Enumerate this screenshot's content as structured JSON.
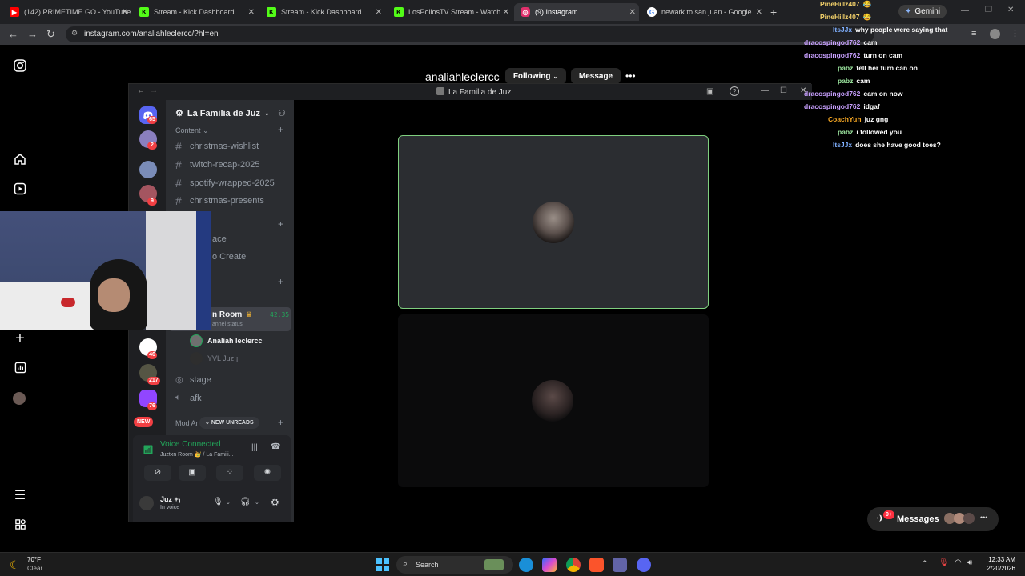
{
  "browser": {
    "tabs": [
      {
        "title": "(142) PRIMETIME GO - YouTube",
        "icon": "youtube-icon",
        "color": "#ff0000"
      },
      {
        "title": "Stream - Kick Dashboard",
        "icon": "kick-icon",
        "color": "#53fc18"
      },
      {
        "title": "Stream - Kick Dashboard",
        "icon": "kick-icon",
        "color": "#53fc18"
      },
      {
        "title": "LosPollosTV Stream - Watch Li",
        "icon": "kick-icon",
        "color": "#53fc18"
      },
      {
        "title": "(9) Instagram",
        "icon": "instagram-icon",
        "color": "#e1306c",
        "active": true
      },
      {
        "title": "newark to san juan - Google Se",
        "icon": "google-icon",
        "color": "#4285f4"
      }
    ],
    "url": "instagram.com/analiahleclercc/?hl=en",
    "gemini_label": "Gemini"
  },
  "instagram": {
    "username": "analiahleclercc",
    "following_label": "Following",
    "message_label": "Message",
    "more_label": "•••",
    "messages_label": "Messages",
    "messages_badge": "9+"
  },
  "discord": {
    "window_title": "La Familia de Juz",
    "server_name": "La Familia de Juz",
    "category_content": "Content",
    "text_channels": [
      "christmas-wishlist",
      "twitch-recap-2025",
      "spotify-wrapped-2025",
      "christmas-presents"
    ],
    "partial_items": [
      "ace",
      "o Create"
    ],
    "voice_room": {
      "name": "n Room",
      "timer": "42:35",
      "status": "annel status"
    },
    "voice_members": [
      "Analiah leclercc",
      "YVL Juz ¡"
    ],
    "other_voice_channels": [
      "stage",
      "afk"
    ],
    "mod_category": "Mod Ar",
    "new_unreads_label": "NEW UNREADS",
    "server_badges": [
      "65",
      "2",
      "9",
      "46",
      "217",
      "76"
    ],
    "new_badge": "NEW",
    "voice_panel": {
      "status": "Voice Connected",
      "room": "Juztxn Room 👑 / La Famili..."
    },
    "user": {
      "name": "Juz +¡",
      "status": "In voice"
    }
  },
  "chat": [
    {
      "user": "PineHillz407",
      "text": "😂"
    },
    {
      "user": "PineHillz407",
      "text": "😂"
    },
    {
      "user": "ItsJJx",
      "text": "why people were saying that"
    },
    {
      "user": "dracospingod762",
      "text": "cam"
    },
    {
      "user": "dracospingod762",
      "text": "turn on cam"
    },
    {
      "user": "pabz",
      "text": "tell her turn can on"
    },
    {
      "user": "pabz",
      "text": "cam"
    },
    {
      "user": "dracospingod762",
      "text": "cam on now"
    },
    {
      "user": "dracospingod762",
      "text": "idgaf"
    },
    {
      "user": "CoachYuh",
      "text": "juz gng"
    },
    {
      "user": "pabz",
      "text": "i followed you"
    },
    {
      "user": "ItsJJx",
      "text": "does she have good toes?"
    }
  ],
  "taskbar": {
    "weather_temp": "70°F",
    "weather_cond": "Clear",
    "search_label": "Search",
    "time": "12:33 AM",
    "date": "2/20/2026"
  },
  "colors": {
    "voice_green": "#23a55a",
    "speaking_border": "#7fcf7f",
    "discord_red": "#f23f43"
  }
}
